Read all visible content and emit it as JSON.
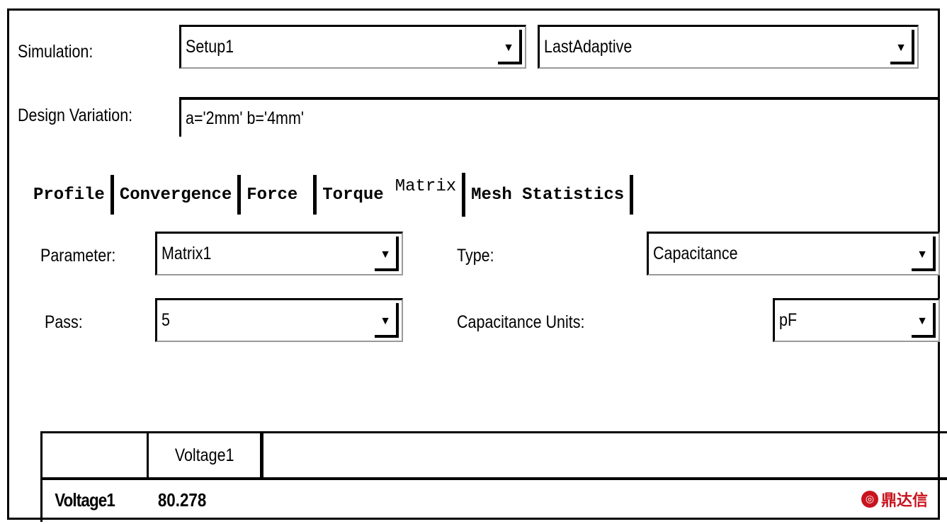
{
  "simulation": {
    "label": "Simulation:",
    "setup": "Setup1",
    "solution": "LastAdaptive"
  },
  "design_variation": {
    "label": "Design Variation:",
    "value": "a='2mm' b='4mm'"
  },
  "tabs": [
    {
      "label": "Profile"
    },
    {
      "label": "Convergence"
    },
    {
      "label": "Force"
    },
    {
      "label": "Torque"
    },
    {
      "label": "Matrix"
    },
    {
      "label": "Mesh Statistics"
    }
  ],
  "matrix": {
    "parameter_label": "Parameter:",
    "parameter_value": "Matrix1",
    "type_label": "Type:",
    "type_value": "Capacitance",
    "pass_label": "Pass:",
    "pass_value": "5",
    "units_label": "Capacitance Units:",
    "units_value": "pF"
  },
  "table": {
    "corner": "",
    "columns": [
      "Voltage1"
    ],
    "rows": [
      {
        "name": "Voltage1",
        "values": [
          "80.278"
        ]
      }
    ]
  },
  "watermark": "鼎达信",
  "dropdown_glyph": "▼"
}
